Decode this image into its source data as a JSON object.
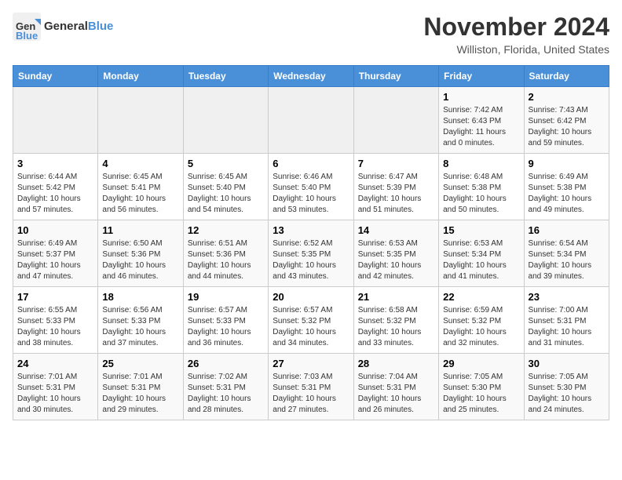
{
  "logo": {
    "general": "General",
    "blue": "Blue"
  },
  "title": "November 2024",
  "location": "Williston, Florida, United States",
  "days_header": [
    "Sunday",
    "Monday",
    "Tuesday",
    "Wednesday",
    "Thursday",
    "Friday",
    "Saturday"
  ],
  "weeks": [
    [
      {
        "day": "",
        "info": ""
      },
      {
        "day": "",
        "info": ""
      },
      {
        "day": "",
        "info": ""
      },
      {
        "day": "",
        "info": ""
      },
      {
        "day": "",
        "info": ""
      },
      {
        "day": "1",
        "info": "Sunrise: 7:42 AM\nSunset: 6:43 PM\nDaylight: 11 hours and 0 minutes."
      },
      {
        "day": "2",
        "info": "Sunrise: 7:43 AM\nSunset: 6:42 PM\nDaylight: 10 hours and 59 minutes."
      }
    ],
    [
      {
        "day": "3",
        "info": "Sunrise: 6:44 AM\nSunset: 5:42 PM\nDaylight: 10 hours and 57 minutes."
      },
      {
        "day": "4",
        "info": "Sunrise: 6:45 AM\nSunset: 5:41 PM\nDaylight: 10 hours and 56 minutes."
      },
      {
        "day": "5",
        "info": "Sunrise: 6:45 AM\nSunset: 5:40 PM\nDaylight: 10 hours and 54 minutes."
      },
      {
        "day": "6",
        "info": "Sunrise: 6:46 AM\nSunset: 5:40 PM\nDaylight: 10 hours and 53 minutes."
      },
      {
        "day": "7",
        "info": "Sunrise: 6:47 AM\nSunset: 5:39 PM\nDaylight: 10 hours and 51 minutes."
      },
      {
        "day": "8",
        "info": "Sunrise: 6:48 AM\nSunset: 5:38 PM\nDaylight: 10 hours and 50 minutes."
      },
      {
        "day": "9",
        "info": "Sunrise: 6:49 AM\nSunset: 5:38 PM\nDaylight: 10 hours and 49 minutes."
      }
    ],
    [
      {
        "day": "10",
        "info": "Sunrise: 6:49 AM\nSunset: 5:37 PM\nDaylight: 10 hours and 47 minutes."
      },
      {
        "day": "11",
        "info": "Sunrise: 6:50 AM\nSunset: 5:36 PM\nDaylight: 10 hours and 46 minutes."
      },
      {
        "day": "12",
        "info": "Sunrise: 6:51 AM\nSunset: 5:36 PM\nDaylight: 10 hours and 44 minutes."
      },
      {
        "day": "13",
        "info": "Sunrise: 6:52 AM\nSunset: 5:35 PM\nDaylight: 10 hours and 43 minutes."
      },
      {
        "day": "14",
        "info": "Sunrise: 6:53 AM\nSunset: 5:35 PM\nDaylight: 10 hours and 42 minutes."
      },
      {
        "day": "15",
        "info": "Sunrise: 6:53 AM\nSunset: 5:34 PM\nDaylight: 10 hours and 41 minutes."
      },
      {
        "day": "16",
        "info": "Sunrise: 6:54 AM\nSunset: 5:34 PM\nDaylight: 10 hours and 39 minutes."
      }
    ],
    [
      {
        "day": "17",
        "info": "Sunrise: 6:55 AM\nSunset: 5:33 PM\nDaylight: 10 hours and 38 minutes."
      },
      {
        "day": "18",
        "info": "Sunrise: 6:56 AM\nSunset: 5:33 PM\nDaylight: 10 hours and 37 minutes."
      },
      {
        "day": "19",
        "info": "Sunrise: 6:57 AM\nSunset: 5:33 PM\nDaylight: 10 hours and 36 minutes."
      },
      {
        "day": "20",
        "info": "Sunrise: 6:57 AM\nSunset: 5:32 PM\nDaylight: 10 hours and 34 minutes."
      },
      {
        "day": "21",
        "info": "Sunrise: 6:58 AM\nSunset: 5:32 PM\nDaylight: 10 hours and 33 minutes."
      },
      {
        "day": "22",
        "info": "Sunrise: 6:59 AM\nSunset: 5:32 PM\nDaylight: 10 hours and 32 minutes."
      },
      {
        "day": "23",
        "info": "Sunrise: 7:00 AM\nSunset: 5:31 PM\nDaylight: 10 hours and 31 minutes."
      }
    ],
    [
      {
        "day": "24",
        "info": "Sunrise: 7:01 AM\nSunset: 5:31 PM\nDaylight: 10 hours and 30 minutes."
      },
      {
        "day": "25",
        "info": "Sunrise: 7:01 AM\nSunset: 5:31 PM\nDaylight: 10 hours and 29 minutes."
      },
      {
        "day": "26",
        "info": "Sunrise: 7:02 AM\nSunset: 5:31 PM\nDaylight: 10 hours and 28 minutes."
      },
      {
        "day": "27",
        "info": "Sunrise: 7:03 AM\nSunset: 5:31 PM\nDaylight: 10 hours and 27 minutes."
      },
      {
        "day": "28",
        "info": "Sunrise: 7:04 AM\nSunset: 5:31 PM\nDaylight: 10 hours and 26 minutes."
      },
      {
        "day": "29",
        "info": "Sunrise: 7:05 AM\nSunset: 5:30 PM\nDaylight: 10 hours and 25 minutes."
      },
      {
        "day": "30",
        "info": "Sunrise: 7:05 AM\nSunset: 5:30 PM\nDaylight: 10 hours and 24 minutes."
      }
    ]
  ]
}
